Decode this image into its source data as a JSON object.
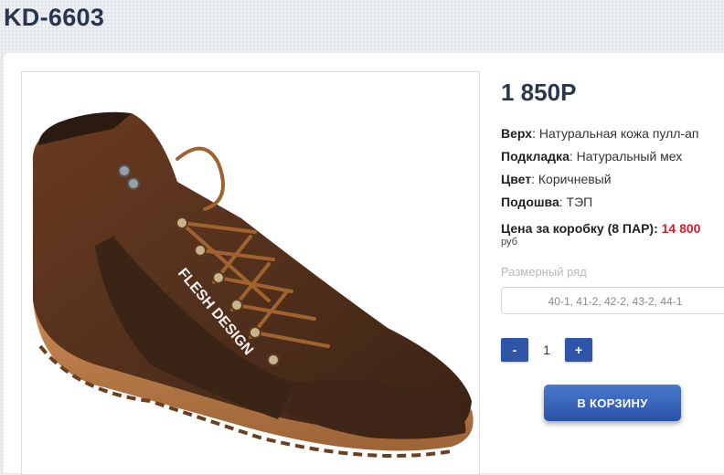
{
  "product": {
    "title": "KD-6603",
    "price": "1 850Р",
    "image_alt": "FLESH DESIGN",
    "specs": [
      {
        "label": "Верх",
        "value": ": Натуральная кожа пулл-ап"
      },
      {
        "label": "Подкладка",
        "value": ": Натуральный мех"
      },
      {
        "label": "Цвет",
        "value": ": Коричневый"
      },
      {
        "label": "Подошва",
        "value": ": ТЭП"
      }
    ],
    "box_price_label": "Цена за коробку (8 ПАР): ",
    "box_price_value": "14 800",
    "box_price_currency": "руб"
  },
  "size": {
    "label": "Размерный ряд",
    "selected": "40-1, 41-2, 42-2, 43-2, 44-1"
  },
  "quantity": {
    "minus_label": "-",
    "value": "1",
    "plus_label": "+"
  },
  "cart": {
    "button_label": "В КОРЗИНУ"
  },
  "colors": {
    "accent": "#2f55a8",
    "price_red": "#d21f2a",
    "title": "#2a3550"
  }
}
